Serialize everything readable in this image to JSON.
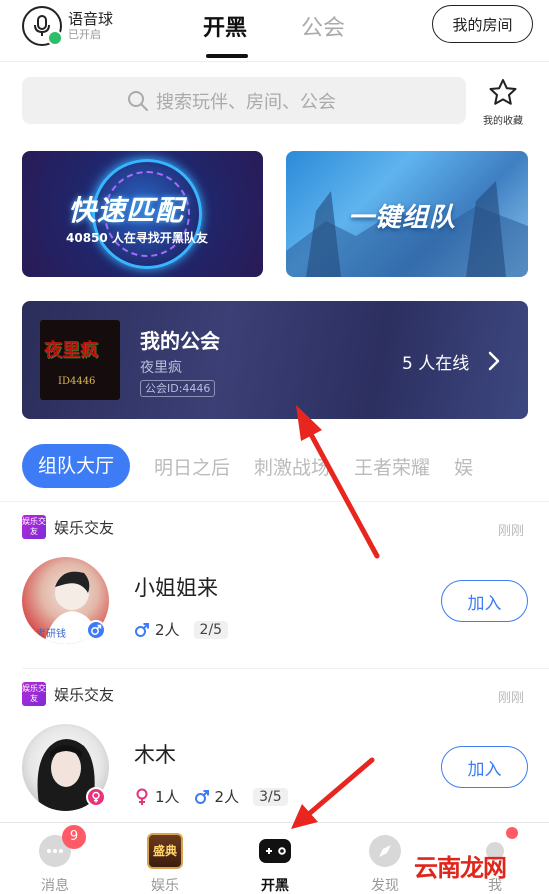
{
  "header": {
    "voice_title": "语音球",
    "voice_status": "已开启",
    "tabs": [
      "开黑",
      "公会"
    ],
    "my_room": "我的房间"
  },
  "search": {
    "placeholder": "搜索玩伴、房间、公会",
    "fav_label": "我的收藏"
  },
  "banners": {
    "match_title": "快速匹配",
    "match_sub": "40850 人在寻找开黑队友",
    "team_title": "一键组队"
  },
  "guild": {
    "logo_text": "夜里疯",
    "logo_id": "ID4446",
    "title": "我的公会",
    "name": "夜里疯",
    "id_label": "公会ID:4446",
    "online": "5 人在线"
  },
  "categories": [
    "组队大厅",
    "明日之后",
    "刺激战场",
    "王者荣耀",
    "娱"
  ],
  "rooms": [
    {
      "tag": "娱乐交友",
      "tag_icon": "娱乐交友",
      "time": "刚刚",
      "name": "小姐姐来",
      "male": "2人",
      "capacity": "2/5",
      "join": "加入",
      "avatar_caption": "考研钱"
    },
    {
      "tag": "娱乐交友",
      "tag_icon": "娱乐交友",
      "time": "刚刚",
      "name": "木木",
      "female": "1人",
      "male": "2人",
      "capacity": "3/5",
      "join": "加入"
    }
  ],
  "nav": [
    {
      "label": "消息",
      "badge": "9"
    },
    {
      "label": "娱乐",
      "icon_text": "盛典"
    },
    {
      "label": "开黑"
    },
    {
      "label": "发现"
    },
    {
      "label": "我"
    }
  ],
  "watermark": "云南龙网",
  "colors": {
    "accent": "#3d7cf4",
    "badge": "#ff5b67",
    "male": "#3d7cf4",
    "female": "#e8337a",
    "arrow": "#e8261f"
  }
}
